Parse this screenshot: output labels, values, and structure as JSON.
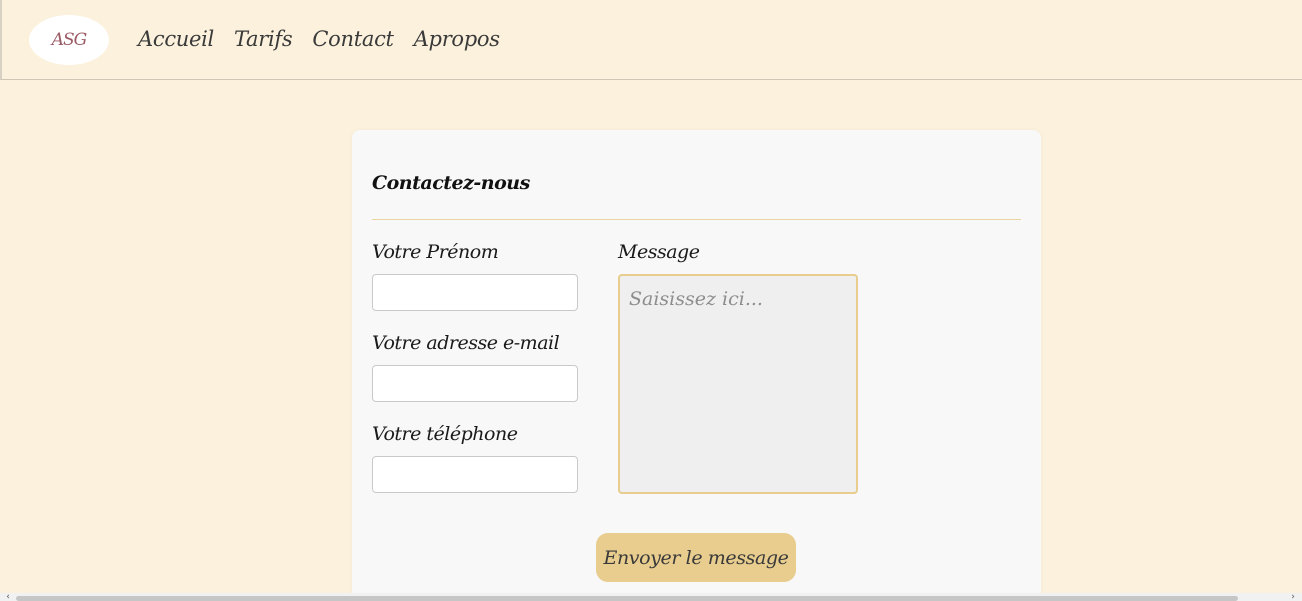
{
  "navbar": {
    "logo_text": "ASG",
    "links": [
      {
        "label": "Accueil"
      },
      {
        "label": "Tarifs"
      },
      {
        "label": "Contact"
      },
      {
        "label": "Apropos"
      }
    ]
  },
  "contact_form": {
    "title": "Contactez-nous",
    "fields": {
      "first_name": {
        "label": "Votre Prénom",
        "value": ""
      },
      "email": {
        "label": "Votre adresse e-mail",
        "value": ""
      },
      "phone": {
        "label": "Votre téléphone",
        "value": ""
      },
      "message": {
        "label": "Message",
        "placeholder": "Saisissez ici...",
        "value": ""
      }
    },
    "submit_label": "Envoyer le message"
  },
  "colors": {
    "page_background": "#fbf1dc",
    "card_background": "#f8f8f8",
    "accent": "#e8cd8e"
  }
}
